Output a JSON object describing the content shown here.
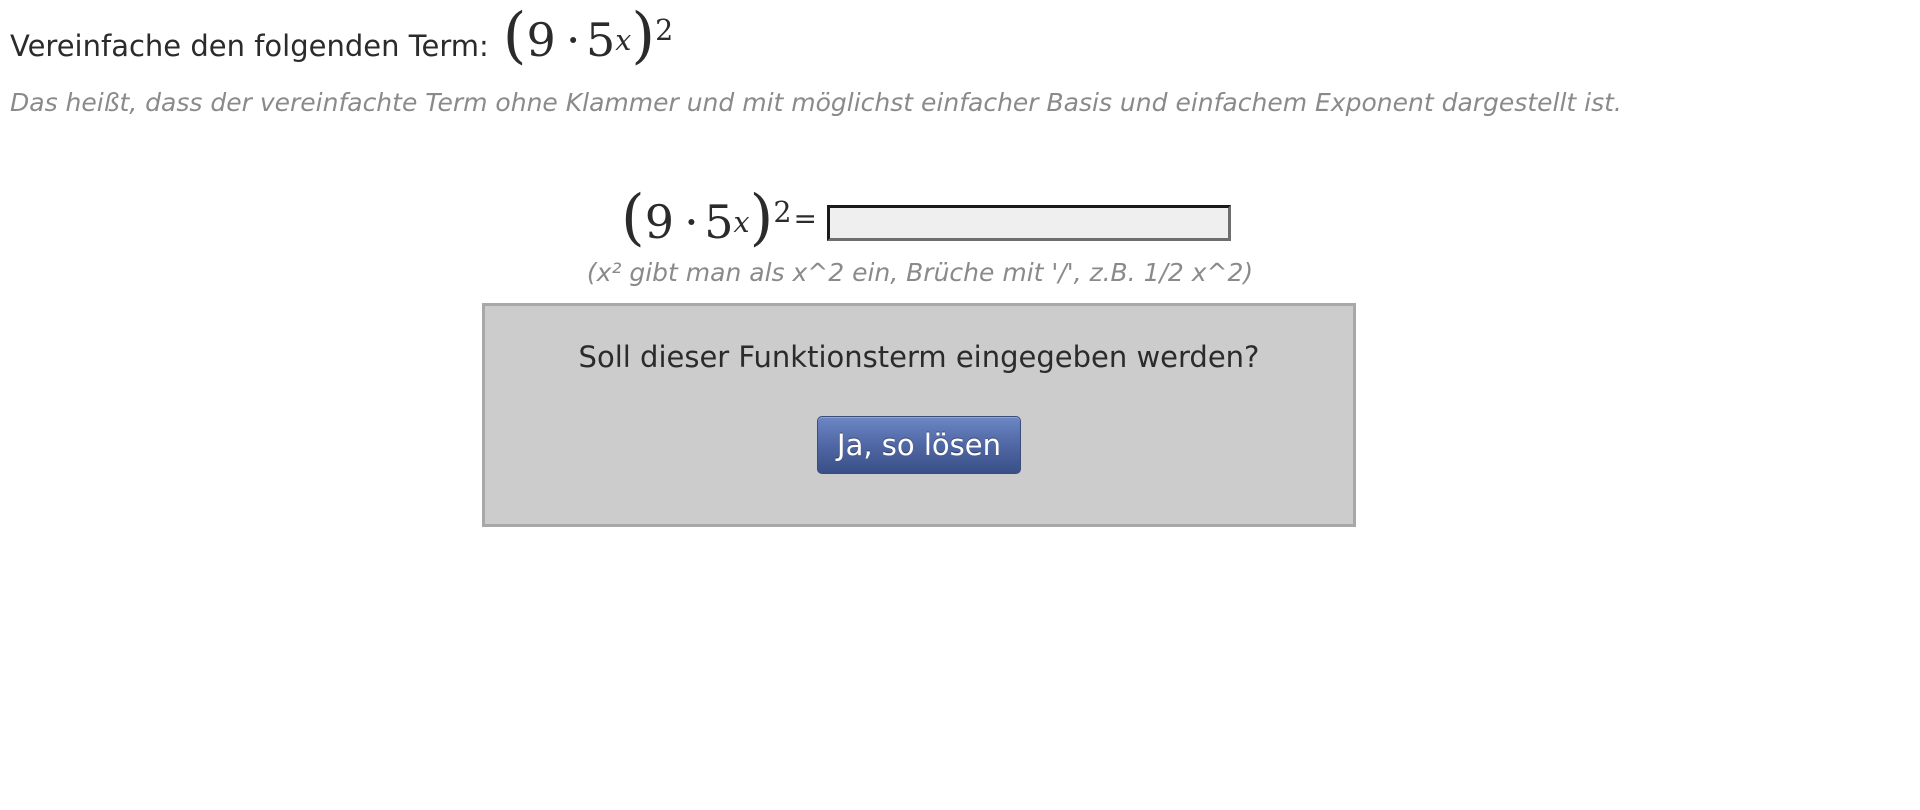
{
  "task": {
    "instruction": "Vereinfache den folgenden Term:",
    "term": {
      "open": "(",
      "base_coef": "9",
      "dot": "·",
      "base": "5",
      "inner_exp": "x",
      "close": ")",
      "outer_exp": "2"
    },
    "hint": "Das heißt, dass der vereinfachte Term ohne Klammer und mit möglichst einfacher Basis und einfachem Exponent dargestellt ist."
  },
  "equation": {
    "equals": "=",
    "input_value": "",
    "input_placeholder": "",
    "format_hint": "(x² gibt man als x^2 ein, Brüche mit '/', z.B. 1/2 x^2)"
  },
  "confirm": {
    "question": "Soll dieser Funktionsterm eingegeben werden?",
    "button_label": "Ja, so lösen"
  },
  "colors": {
    "text": "#2b2b2b",
    "muted": "#8a8a8a",
    "box_bg": "#cccccc",
    "box_border": "#a8a8a8",
    "button": "#526aa8",
    "input_bg": "#efefef"
  }
}
